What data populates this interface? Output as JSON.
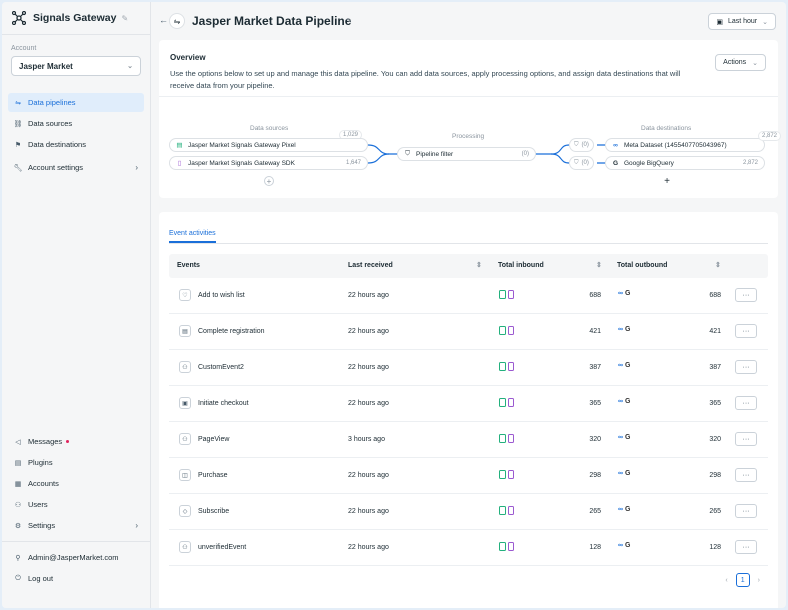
{
  "app": {
    "name": "Signals Gateway"
  },
  "account": {
    "label": "Account",
    "selected": "Jasper Market"
  },
  "nav": {
    "items": [
      {
        "label": "Data pipelines",
        "icon": "pipeline-icon"
      },
      {
        "label": "Data sources",
        "icon": "link-icon"
      },
      {
        "label": "Data destinations",
        "icon": "flag-icon"
      },
      {
        "label": "Account settings",
        "icon": "wrench-icon"
      }
    ],
    "bottom": [
      {
        "label": "Messages",
        "icon": "megaphone-icon"
      },
      {
        "label": "Plugins",
        "icon": "plugin-icon"
      },
      {
        "label": "Accounts",
        "icon": "accounts-icon"
      },
      {
        "label": "Users",
        "icon": "users-icon"
      },
      {
        "label": "Settings",
        "icon": "gear-icon"
      }
    ],
    "user": "Admin@JasperMarket.com",
    "logout": "Log out"
  },
  "header": {
    "title": "Jasper Market Data Pipeline",
    "time_range": "Last hour"
  },
  "overview": {
    "title": "Overview",
    "description": "Use the options below to set up and manage this data pipeline. You can add data sources, apply processing options, and assign data destinations that will receive data from your pipeline.",
    "actions_label": "Actions",
    "sources_title": "Data sources",
    "processing_title": "Processing",
    "destinations_title": "Data destinations",
    "sources_total": "1,029",
    "destinations_total": "2,872",
    "sources": [
      {
        "name": "Jasper Market Signals Gateway Pixel",
        "count": ""
      },
      {
        "name": "Jasper Market Signals Gateway SDK",
        "count": "1,647"
      }
    ],
    "processing": {
      "name": "Pipeline filter",
      "count": "(0)"
    },
    "filter_counts": [
      "(0)",
      "(0)"
    ],
    "destinations": [
      {
        "name": "Meta Dataset (1455407705043967)",
        "count": ""
      },
      {
        "name": "Google BigQuery",
        "count": "2,872"
      }
    ]
  },
  "events": {
    "tab": "Event activities",
    "columns": {
      "events": "Events",
      "last_received": "Last received",
      "inbound": "Total inbound",
      "outbound": "Total outbound"
    },
    "more_label": "···",
    "rows": [
      {
        "name": "Add to wish list",
        "icon": "heart-icon",
        "time": "22 hours ago",
        "inbound": "688",
        "outbound": "688"
      },
      {
        "name": "Complete registration",
        "icon": "form-icon",
        "time": "22 hours ago",
        "inbound": "421",
        "outbound": "421"
      },
      {
        "name": "CustomEvent2",
        "icon": "hierarchy-icon",
        "time": "22 hours ago",
        "inbound": "387",
        "outbound": "387"
      },
      {
        "name": "Initiate checkout",
        "icon": "checkout-icon",
        "time": "22 hours ago",
        "inbound": "365",
        "outbound": "365"
      },
      {
        "name": "PageView",
        "icon": "hierarchy-icon",
        "time": "3 hours ago",
        "inbound": "320",
        "outbound": "320"
      },
      {
        "name": "Purchase",
        "icon": "bag-icon",
        "time": "22 hours ago",
        "inbound": "298",
        "outbound": "298"
      },
      {
        "name": "Subscribe",
        "icon": "tag-icon",
        "time": "22 hours ago",
        "inbound": "265",
        "outbound": "265"
      },
      {
        "name": "unverifiedEvent",
        "icon": "hierarchy-icon",
        "time": "22 hours ago",
        "inbound": "128",
        "outbound": "128"
      }
    ],
    "page": "1"
  }
}
